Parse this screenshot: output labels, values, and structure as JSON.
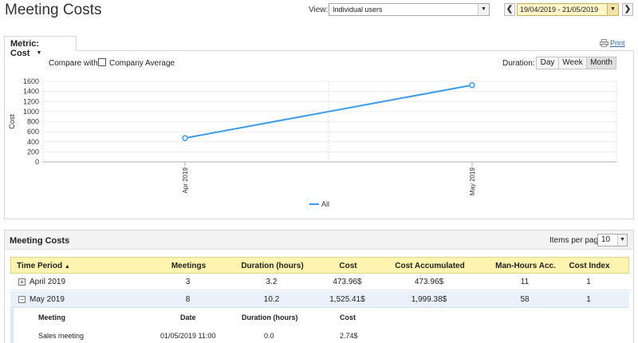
{
  "header": {
    "title": "Meeting Costs"
  },
  "view": {
    "label": "View:",
    "value": "Individual users"
  },
  "date_range": {
    "prev": "❮",
    "value": "19/04/2019 - 21/05/2019",
    "next": "❯"
  },
  "metric_tab": {
    "label": "Metric: Cost"
  },
  "print": {
    "label": "Print"
  },
  "compare": {
    "label": "Compare with:",
    "option": "Company Average",
    "checked": false
  },
  "duration": {
    "label": "Duration:",
    "options": [
      "Day",
      "Week",
      "Month"
    ],
    "selected": "Month"
  },
  "chart_data": {
    "type": "line",
    "categories": [
      "Apr 2019",
      "May 2019"
    ],
    "series": [
      {
        "name": "All",
        "values": [
          473.96,
          1525.41
        ],
        "color": "#3d9be9"
      }
    ],
    "ylabel": "Cost",
    "ylim": [
      0,
      1600
    ],
    "yticks": [
      0,
      200,
      400,
      600,
      800,
      1000,
      1200,
      1400,
      1600
    ],
    "grid": true,
    "legend": "bottom-center"
  },
  "table_panel": {
    "title": "Meeting Costs",
    "items_per_page_label": "Items per page",
    "items_per_page": "10"
  },
  "table": {
    "headers": [
      "Time Period",
      "Meetings",
      "Duration (hours)",
      "Cost",
      "Cost Accumulated",
      "Man-Hours Acc.",
      "Cost Index"
    ],
    "sort_indicator": "▲",
    "rows": [
      {
        "period": "April 2019",
        "meetings": "3",
        "duration": "3.2",
        "cost": "473.96$",
        "cost_acc": "473.96$",
        "man_hours": "11",
        "cost_index": "1",
        "expanded": false,
        "toggle": "+"
      },
      {
        "period": "May 2019",
        "meetings": "8",
        "duration": "10.2",
        "cost": "1,525.41$",
        "cost_acc": "1,999.38$",
        "man_hours": "58",
        "cost_index": "1",
        "expanded": true,
        "toggle": "−"
      }
    ]
  },
  "detail": {
    "headers": [
      "Meeting",
      "Date",
      "Duration (hours)",
      "Cost"
    ],
    "rows": [
      {
        "meeting": "Sales meeting",
        "date": "01/05/2019 11:00",
        "duration": "0.0",
        "cost": "2.74$"
      }
    ]
  }
}
